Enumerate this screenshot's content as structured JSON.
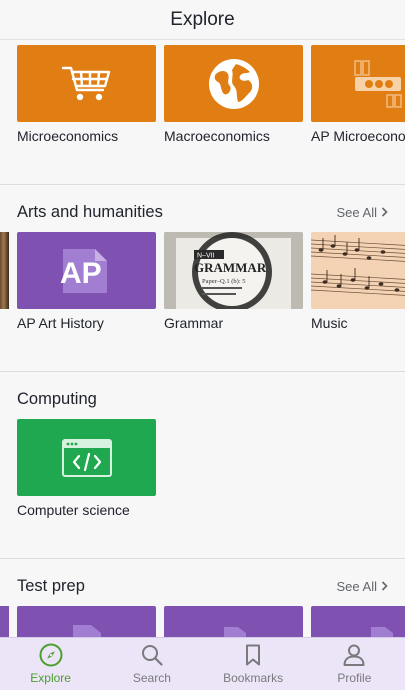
{
  "header": {
    "title": "Explore"
  },
  "sections": {
    "economics": {
      "tiles": [
        {
          "label": "Microeconomics",
          "icon": "shopping-cart-icon"
        },
        {
          "label": "Macroeconomics",
          "icon": "globe-icon"
        },
        {
          "label": "AP Microeconomics",
          "icon": "money-icon"
        }
      ]
    },
    "arts": {
      "title": "Arts and humanities",
      "see_all": "See All",
      "tiles": [
        {
          "label": "AP Art History",
          "icon": "ap-logo-icon"
        },
        {
          "label": "Grammar",
          "icon": "magnifier-grammar-image"
        },
        {
          "label": "Music",
          "icon": "sheet-music-image"
        }
      ]
    },
    "computing": {
      "title": "Computing",
      "tiles": [
        {
          "label": "Computer science",
          "icon": "code-window-icon"
        }
      ]
    },
    "test_prep": {
      "title": "Test prep",
      "see_all": "See All"
    }
  },
  "grammar_image_text": {
    "top": "N–VII",
    "word": "GRAMMAR",
    "line": "Paper–Q.1 (b): 5"
  },
  "ap_text": "AP",
  "tabbar": {
    "tabs": [
      {
        "label": "Explore",
        "icon": "compass-icon",
        "active": true
      },
      {
        "label": "Search",
        "icon": "search-icon",
        "active": false
      },
      {
        "label": "Bookmarks",
        "icon": "bookmark-icon",
        "active": false
      },
      {
        "label": "Profile",
        "icon": "profile-icon",
        "active": false
      }
    ]
  },
  "colors": {
    "orange": "#e07e13",
    "purple": "#7f52b1",
    "green": "#1fa84f",
    "accent": "#4aa02c"
  }
}
